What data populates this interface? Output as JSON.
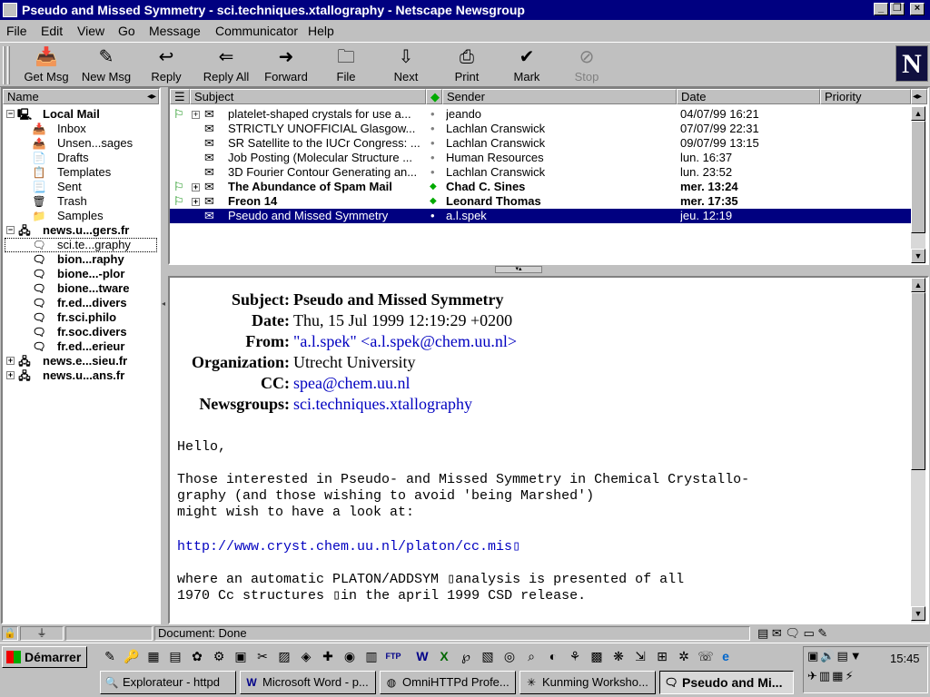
{
  "window": {
    "title": "Pseudo and Missed Symmetry - sci.techniques.xtallography - Netscape Newsgroup",
    "min_glyph": "_",
    "max_glyph": "❐",
    "close_glyph": "×"
  },
  "menu": {
    "file": "File",
    "edit": "Edit",
    "view": "View",
    "go": "Go",
    "message": "Message",
    "communicator": "Communicator",
    "help": "Help"
  },
  "toolbar": {
    "getmsg": "Get Msg",
    "newmsg": "New Msg",
    "reply": "Reply",
    "replyall": "Reply All",
    "forward": "Forward",
    "file": "File",
    "next": "Next",
    "print": "Print",
    "mark": "Mark",
    "stop": "Stop",
    "logo": "N"
  },
  "folders": {
    "header": "Name",
    "local_mail": "Local Mail",
    "inbox": "Inbox",
    "unsent": "Unsen...sages",
    "drafts": "Drafts",
    "templates": "Templates",
    "sent": "Sent",
    "trash": "Trash",
    "samples": "Samples",
    "server1": "news.u...gers.fr",
    "sci_tech": "sci.te...graphy",
    "bion": "bion...raphy",
    "bione_plor": "bione...-plor",
    "bione_tware": "bione...tware",
    "fr_ed_divers": "fr.ed...divers",
    "fr_sci_philo": "fr.sci.philo",
    "fr_soc_divers": "fr.soc.divers",
    "fr_ed_erieur": "fr.ed...erieur",
    "server2": "news.e...sieu.fr",
    "server3": "news.u...ans.fr"
  },
  "message_list": {
    "headers": {
      "subject": "Subject",
      "sender": "Sender",
      "date": "Date",
      "priority": "Priority"
    },
    "rows": [
      {
        "subject": "platelet-shaped crystals for use a...",
        "sender": "jeando",
        "date": "04/07/99 16:21"
      },
      {
        "subject": "STRICTLY UNOFFICIAL Glasgow...",
        "sender": "Lachlan Cranswick",
        "date": "07/07/99 22:31"
      },
      {
        "subject": "SR Satellite to the IUCr Congress: ...",
        "sender": "Lachlan Cranswick",
        "date": "09/07/99 13:15"
      },
      {
        "subject": "Job Posting (Molecular Structure ...",
        "sender": "Human Resources",
        "date": "lun. 16:37"
      },
      {
        "subject": "3D Fourier Contour Generating an...",
        "sender": "Lachlan Cranswick",
        "date": "lun. 23:52"
      },
      {
        "subject": "The Abundance of Spam Mail",
        "sender": "Chad C. Sines",
        "date": "mer. 13:24"
      },
      {
        "subject": "Freon 14",
        "sender": "Leonard Thomas",
        "date": "mer. 17:35"
      },
      {
        "subject": "Pseudo and Missed Symmetry",
        "sender": "a.l.spek",
        "date": "jeu. 12:19"
      }
    ]
  },
  "message": {
    "labels": {
      "subject": "Subject:",
      "date": "Date:",
      "from": "From:",
      "organization": "Organization:",
      "cc": "CC:",
      "newsgroups": "Newsgroups:"
    },
    "subject": "Pseudo and Missed Symmetry",
    "date": "Thu, 15 Jul 1999 12:19:29 +0200",
    "from": "\"a.l.spek\" <a.l.spek@chem.uu.nl>",
    "organization": "Utrecht University",
    "cc": "spea@chem.uu.nl",
    "newsgroups": "sci.techniques.xtallography",
    "body": {
      "line1": "Hello,",
      "line2": "Those interested in Pseudo- and Missed Symmetry in Chemical Crystallo-",
      "line3": "graphy (and those wishing to avoid 'being Marshed')",
      "line4": "might wish to have a look at:",
      "url": "http://www.cryst.chem.uu.nl/platon/cc.mis▯",
      "line5": "where an automatic PLATON/ADDSYM ▯analysis is presented of all",
      "line6": "1970 Cc structures ▯in the april 1999 CSD release."
    }
  },
  "statusbar": {
    "text": "Document: Done"
  },
  "taskbar": {
    "start": "Démarrer",
    "tasks": {
      "explorer": "Explorateur - httpd",
      "word": "Microsoft Word - p...",
      "omni": "OmniHTTPd Profe...",
      "kunming": "Kunming Worksho...",
      "pseudo": "Pseudo and Mi..."
    },
    "clock": "15:45"
  }
}
